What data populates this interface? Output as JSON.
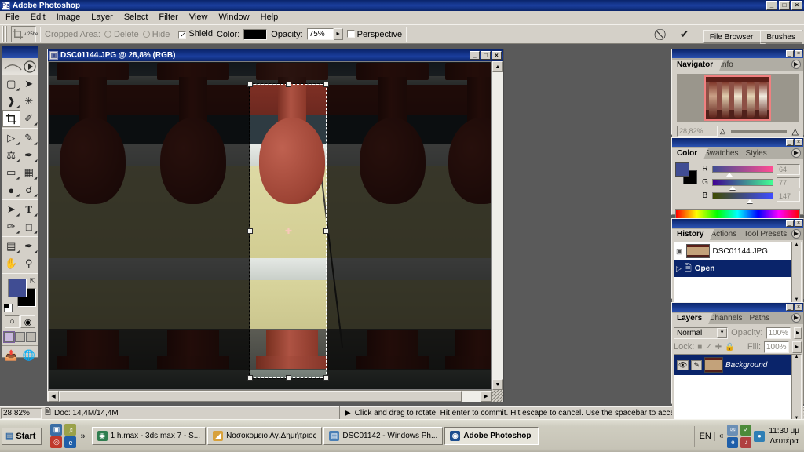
{
  "app": {
    "title": "Adobe Photoshop",
    "window_buttons": [
      "_",
      "□",
      "×"
    ]
  },
  "menu": {
    "items": [
      "File",
      "Edit",
      "Image",
      "Layer",
      "Select",
      "Filter",
      "View",
      "Window",
      "Help"
    ]
  },
  "options_bar": {
    "tool_icon": "crop-tool-icon",
    "cropped_area_label": "Cropped Area:",
    "delete_label": "Delete",
    "hide_label": "Hide",
    "shield_label": "Shield",
    "shield_checked": "✓",
    "color_label": "Color:",
    "shield_color": "#000000",
    "opacity_label": "Opacity:",
    "opacity_value": "75%",
    "perspective_label": "Perspective",
    "perspective_checked": "",
    "cancel_icon": "⃠",
    "commit_icon": "✔",
    "palette_well": [
      "File Browser",
      "Brushes"
    ]
  },
  "toolbox": {
    "tools": [
      {
        "name": "rectangular-marquee-tool",
        "glyph": "⬚",
        "selected": false
      },
      {
        "name": "move-tool",
        "glyph": "➤",
        "selected": false
      },
      {
        "name": "lasso-tool",
        "glyph": "❁",
        "selected": false
      },
      {
        "name": "magic-wand-tool",
        "glyph": "✳",
        "selected": false
      },
      {
        "name": "crop-tool",
        "glyph": "⌗",
        "selected": true
      },
      {
        "name": "slice-tool",
        "glyph": "✂",
        "selected": false
      },
      {
        "name": "healing-brush-tool",
        "glyph": "✐",
        "selected": false
      },
      {
        "name": "brush-tool",
        "glyph": "✎",
        "selected": false
      },
      {
        "name": "clone-stamp-tool",
        "glyph": "♟",
        "selected": false
      },
      {
        "name": "history-brush-tool",
        "glyph": "✒",
        "selected": false
      },
      {
        "name": "eraser-tool",
        "glyph": "▭",
        "selected": false
      },
      {
        "name": "gradient-tool",
        "glyph": "▨",
        "selected": false
      },
      {
        "name": "blur-tool",
        "glyph": "●",
        "selected": false
      },
      {
        "name": "dodge-tool",
        "glyph": "⚲",
        "selected": false
      },
      {
        "name": "path-selection-tool",
        "glyph": "➤",
        "selected": false
      },
      {
        "name": "type-tool",
        "glyph": "T",
        "selected": false
      },
      {
        "name": "pen-tool",
        "glyph": "✑",
        "selected": false
      },
      {
        "name": "rectangle-tool",
        "glyph": "□",
        "selected": false
      },
      {
        "name": "notes-tool",
        "glyph": "☰",
        "selected": false
      },
      {
        "name": "eyedropper-tool",
        "glyph": "✒",
        "selected": false
      },
      {
        "name": "hand-tool",
        "glyph": "✋",
        "selected": false
      },
      {
        "name": "zoom-tool",
        "glyph": "⚲",
        "selected": false
      }
    ],
    "foreground_color": "#404d93",
    "background_color": "#000000",
    "swap_icon": "swap-colors-icon",
    "default_colors_icon": "default-colors-icon",
    "quick_mask": [
      "standard-mode-icon",
      "quickmask-mode-icon"
    ],
    "screen_modes": [
      "standard-screen-icon",
      "fullscreen-menubar-icon",
      "fullscreen-icon"
    ],
    "jump_to": [
      "jump-to-imageready-icon",
      "jump-to-browser-icon"
    ]
  },
  "document": {
    "title": "DSC01144.JPG @ 28,8% (RGB)",
    "buttons": [
      "_",
      "□",
      "×"
    ],
    "icon": "photoshop-document-icon"
  },
  "status_bar": {
    "zoom": "28,82%",
    "doc_icon": "document-size-icon",
    "doc_info": "Doc: 14,4M/14,4M",
    "hint_arrow": "▶",
    "hint": "Click and drag to rotate. Hit enter to commit. Hit escape to cancel. Use the spacebar to access the navigation tools."
  },
  "navigator": {
    "tabs": [
      "Navigator",
      "Info"
    ],
    "active_tab": "Navigator",
    "zoom_value": "28,82%",
    "view_box_color": "#f08080",
    "zoom_out_icon": "zoom-out-icon",
    "zoom_in_icon": "zoom-in-icon",
    "menu_icon": "palette-menu-icon"
  },
  "color_panel": {
    "tabs": [
      "Color",
      "Swatches",
      "Styles"
    ],
    "active_tab": "Color",
    "channels": [
      {
        "label": "R",
        "value": "64"
      },
      {
        "label": "G",
        "value": "77"
      },
      {
        "label": "B",
        "value": "147"
      }
    ],
    "foreground_color": "#404d93",
    "background_color": "#000000",
    "menu_icon": "palette-menu-icon"
  },
  "history_panel": {
    "tabs": [
      "History",
      "Actions",
      "Tool Presets"
    ],
    "active_tab": "History",
    "snapshot": "DSC01144.JPG",
    "states": [
      {
        "label": "Open",
        "selected": true
      }
    ],
    "footer_icons": [
      "new-document-from-state-icon",
      "new-snapshot-icon",
      "delete-icon"
    ],
    "menu_icon": "palette-menu-icon"
  },
  "layers_panel": {
    "tabs": [
      "Layers",
      "Channels",
      "Paths"
    ],
    "active_tab": "Layers",
    "blend_mode": "Normal",
    "opacity_label": "Opacity:",
    "opacity_value": "100%",
    "lock_label": "Lock:",
    "lock_icons": [
      "lock-transparent-pixels-icon",
      "lock-image-pixels-icon",
      "lock-position-icon",
      "lock-all-icon"
    ],
    "fill_label": "Fill:",
    "fill_value": "100%",
    "layers": [
      {
        "name": "Background",
        "visible": true,
        "locked": true,
        "selected": true,
        "eye_icon": "eye-icon",
        "brush_icon": "paintbrush-icon",
        "lock_icon": "lock-icon"
      }
    ],
    "footer_icons": [
      "layer-style-icon",
      "layer-mask-icon",
      "new-group-icon",
      "adjustment-layer-icon",
      "new-layer-icon",
      "delete-layer-icon"
    ],
    "menu_icon": "palette-menu-icon"
  },
  "taskbar": {
    "start_label": "Start",
    "start_icon": "windows-logo-icon",
    "quick_launch": [
      {
        "name": "show-desktop-icon",
        "glyph": "▤",
        "color": "#3a6ea5"
      },
      {
        "name": "media-player-icon",
        "glyph": "♫",
        "color": "#9aa24a"
      },
      {
        "name": "winamp-icon",
        "glyph": "◎",
        "color": "#c0392b"
      },
      {
        "name": "internet-explorer-icon",
        "glyph": "e",
        "color": "#1f5fa9"
      }
    ],
    "chevron": "»",
    "tasks": [
      {
        "label": "1 h.max - 3ds max 7  - S...",
        "icon": "3dsmax-icon",
        "color": "#2f7d4f",
        "active": false
      },
      {
        "label": "Νοσοκομειο Αγ.Δημήτριος",
        "icon": "folder-icon",
        "color": "#d8a13a",
        "active": false
      },
      {
        "label": "DSC01142 - Windows Ph...",
        "icon": "windows-picture-viewer-icon",
        "color": "#4a7fb5",
        "active": false
      },
      {
        "label": "Adobe Photoshop",
        "icon": "photoshop-icon",
        "color": "#1d4e8f",
        "active": true
      }
    ],
    "tray": {
      "language": "EN",
      "expand_icon": "«",
      "icons": [
        {
          "name": "network-icon",
          "glyph": "✉",
          "color": "#6b8fb5"
        },
        {
          "name": "antivirus-icon",
          "glyph": "✓",
          "color": "#4b8a3a"
        },
        {
          "name": "globe-icon",
          "glyph": "●",
          "color": "#2f7fb5"
        },
        {
          "name": "ie-tray-icon",
          "glyph": "e",
          "color": "#1f5fa9"
        },
        {
          "name": "volume-mute-icon",
          "glyph": "♪",
          "color": "#b04040"
        }
      ],
      "time": "11:30 μμ",
      "day": "Δευτέρα"
    }
  },
  "canvas": {
    "crop_shield_opacity": "75%",
    "crop_handles": 8,
    "pivot_icon": "rotation-pivot-icon",
    "subject": "red balusters balustrade photo"
  }
}
